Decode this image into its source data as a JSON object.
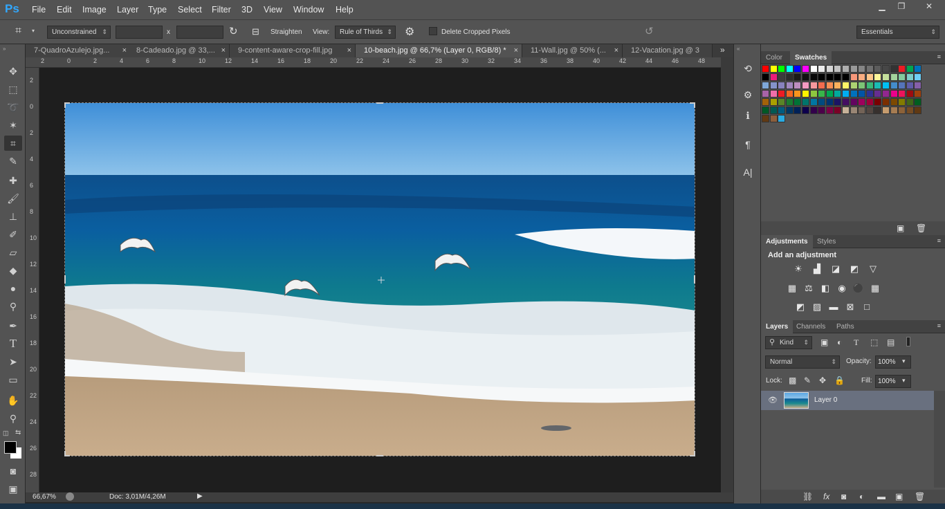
{
  "app": {
    "logo": "Ps"
  },
  "menu": [
    "File",
    "Edit",
    "Image",
    "Layer",
    "Type",
    "Select",
    "Filter",
    "3D",
    "View",
    "Window",
    "Help"
  ],
  "window_controls": {
    "minimize": "▁",
    "restore": "❐",
    "close": "✕"
  },
  "options": {
    "ratio": "Unconstrained",
    "times": "x",
    "straighten": "Straighten",
    "view_label": "View:",
    "view_value": "Rule of Thirds",
    "delete_cropped": "Delete Cropped Pixels",
    "workspace": "Essentials"
  },
  "tabs": [
    {
      "label": "7-QuadroAzulejo.jpg...",
      "close": "×"
    },
    {
      "label": "8-Cadeado.jpg @ 33,...",
      "close": "×"
    },
    {
      "label": "9-content-aware-crop-fill.jpg",
      "close": "×"
    },
    {
      "label": "10-beach.jpg @ 66,7% (Layer 0, RGB/8) *",
      "close": "×"
    },
    {
      "label": "11-Wall.jpg @ 50% (...",
      "close": "×"
    },
    {
      "label": "12-Vacation.jpg @ 3",
      "close": ""
    }
  ],
  "tabs_overflow": "»",
  "ruler_h": [
    "2",
    "0",
    "2",
    "4",
    "6",
    "8",
    "10",
    "12",
    "14",
    "16",
    "18",
    "20",
    "22",
    "24",
    "26",
    "28",
    "30",
    "32",
    "34",
    "36",
    "38",
    "40",
    "42",
    "44",
    "46",
    "48"
  ],
  "ruler_v": [
    "2",
    "0",
    "2",
    "4",
    "6",
    "8",
    "10",
    "12",
    "14",
    "16",
    "18",
    "20",
    "22",
    "24",
    "26",
    "28"
  ],
  "status": {
    "zoom": "66,67%",
    "doc": "Doc: 3,01M/4,26M"
  },
  "panels": {
    "color_tabs": [
      "Color",
      "Swatches"
    ],
    "adjust_tabs": [
      "Adjustments",
      "Styles"
    ],
    "add_adjustment": "Add an adjustment",
    "layers_tabs": [
      "Layers",
      "Channels",
      "Paths"
    ],
    "kind": "Kind",
    "blend": "Normal",
    "opacity_label": "Opacity:",
    "opacity": "100%",
    "lock_label": "Lock:",
    "fill_label": "Fill:",
    "fill": "100%",
    "layer_name": "Layer 0",
    "panel_menu": "≡"
  },
  "swatch_rows": [
    [
      "#ff0000",
      "#ffff00",
      "#00ff00",
      "#00ffff",
      "#0000ff",
      "#ff00ff",
      "#ffffff",
      "#ebebeb",
      "#d6d6d6",
      "#c2c2c2",
      "#adadad",
      "#999999",
      "#858585",
      "#707070",
      "#5c5c5c",
      "#474747",
      "#333333",
      "#ec1c24",
      "#00a651",
      "#0072bc"
    ],
    [
      "#000000",
      "#ed1c79",
      "#3c3c3c",
      "#2b2b2b",
      "#1a1a1a",
      "#111111",
      "#080808",
      "#030303",
      "#000000",
      "#000000",
      "#000000",
      "#f7977a",
      "#f9ad81",
      "#fdc68a",
      "#fff79a",
      "#c4df9b",
      "#a3d39c",
      "#82ca9d",
      "#7bcdc8",
      "#6ecff6"
    ],
    [
      "#7ea7d8",
      "#8493ca",
      "#8882be",
      "#a187be",
      "#bc8dbf",
      "#f49ac2",
      "#f6989d",
      "#f26c4f",
      "#f68e55",
      "#fbaf5c",
      "#fff467",
      "#acd372",
      "#7cc576",
      "#3bb878",
      "#1abbb4",
      "#00bff3",
      "#438ccb",
      "#5574b9",
      "#605ca8",
      "#855fa8"
    ],
    [
      "#a763a8",
      "#f06ea9",
      "#ed1c24",
      "#f26522",
      "#f7941d",
      "#fff200",
      "#8dc63f",
      "#39b54a",
      "#00a651",
      "#00a99d",
      "#00aeef",
      "#0072bc",
      "#0054a6",
      "#2e3192",
      "#662d91",
      "#92278f",
      "#ec008c",
      "#ed145b",
      "#9e0b0f",
      "#a0410d"
    ],
    [
      "#a36209",
      "#aba000",
      "#598527",
      "#1a7b30",
      "#007236",
      "#00746b",
      "#0076a3",
      "#004b80",
      "#003471",
      "#1b1464",
      "#440e62",
      "#630460",
      "#9e005d",
      "#9e0039",
      "#790000",
      "#7b2e00",
      "#7d4900",
      "#827b00",
      "#406618",
      "#005e20"
    ],
    [
      "#005826",
      "#005952",
      "#005b7f",
      "#003663",
      "#002157",
      "#0d004c",
      "#32004b",
      "#4b0049",
      "#7b0046",
      "#7a0026",
      "#c7b299",
      "#998675",
      "#736357",
      "#534741",
      "#37302d",
      "#c69c6e",
      "#a67c52",
      "#8c6239",
      "#754c24",
      "#603913"
    ],
    [
      "#603913",
      "#8b5e3c",
      "#29abe2"
    ]
  ]
}
